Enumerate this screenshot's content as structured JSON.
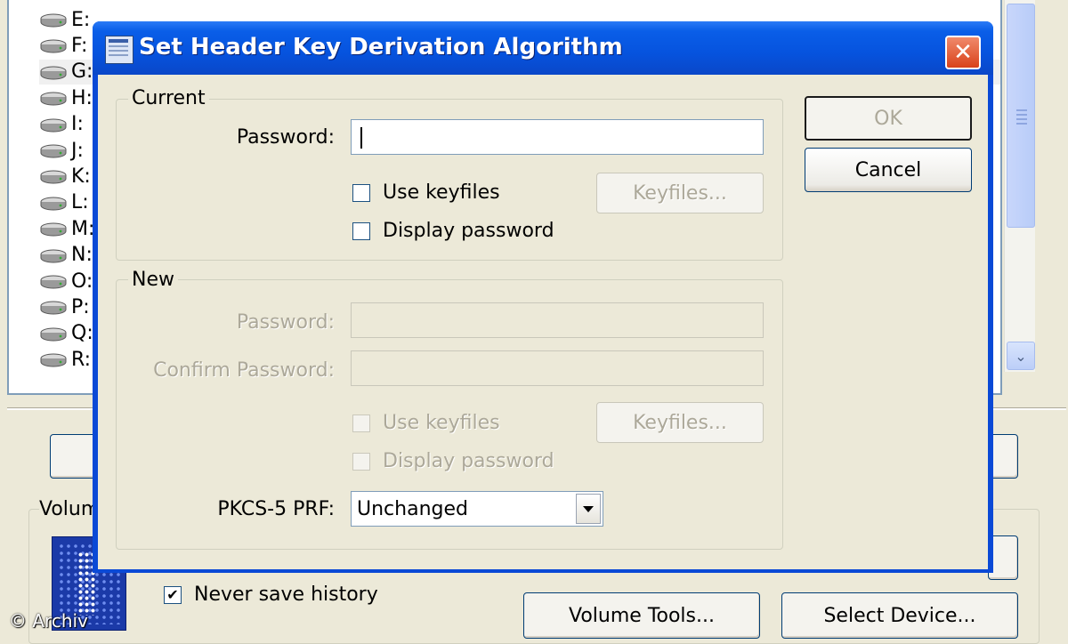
{
  "main": {
    "drives": [
      {
        "letter": "E:"
      },
      {
        "letter": "F:"
      },
      {
        "letter": "G:"
      },
      {
        "letter": "H:"
      },
      {
        "letter": "I:"
      },
      {
        "letter": "J:"
      },
      {
        "letter": "K:"
      },
      {
        "letter": "L:"
      },
      {
        "letter": "M:"
      },
      {
        "letter": "N:"
      },
      {
        "letter": "O:"
      },
      {
        "letter": "P:"
      },
      {
        "letter": "Q:"
      },
      {
        "letter": "R:"
      }
    ],
    "volume_group_label": "Volum",
    "never_save_history_label": "Never save history",
    "never_save_history_checked": true,
    "volume_tools_label": "Volume Tools...",
    "select_device_label": "Select Device...",
    "watermark": "© Archiv"
  },
  "dialog": {
    "title": "Set Header Key Derivation Algorithm",
    "close_glyph": "✕",
    "current": {
      "group_label": "Current",
      "password_label": "Password:",
      "password_value": "",
      "use_keyfiles_label": "Use keyfiles",
      "use_keyfiles_checked": false,
      "keyfiles_button": "Keyfiles...",
      "display_password_label": "Display password",
      "display_password_checked": false
    },
    "new": {
      "group_label": "New",
      "password_label": "Password:",
      "confirm_label": "Confirm Password:",
      "use_keyfiles_label": "Use keyfiles",
      "keyfiles_button": "Keyfiles...",
      "display_password_label": "Display password",
      "prf_label": "PKCS-5 PRF:",
      "prf_value": "Unchanged"
    },
    "ok_label": "OK",
    "cancel_label": "Cancel"
  },
  "colors": {
    "title_bar": "#0a5ee8",
    "close_button": "#d9421a",
    "window_bg": "#ece9d8",
    "disabled_text": "#aca899"
  }
}
